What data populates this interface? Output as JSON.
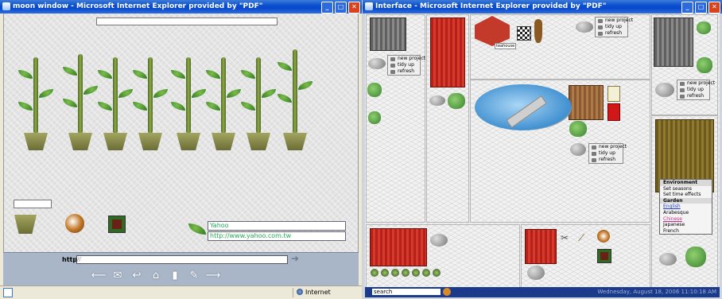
{
  "left_window": {
    "title": "moon window - Microsoft Internet Explorer provided by \"PDF\"",
    "buttons": {
      "minimize": "_",
      "maximize": "□",
      "close": "✕"
    },
    "fields": {
      "name_value": "Yahoo",
      "url_value": "http://www.yahoo.com.tw"
    },
    "address": {
      "label": "http:",
      "value": "//"
    },
    "nav_icons": [
      "⟵",
      "✉",
      "↩",
      "⌂",
      "▮",
      "✎",
      "⟶"
    ],
    "status": {
      "zone": "Internet"
    }
  },
  "right_window": {
    "title": "Interface - Microsoft Internet Explorer provided by \"PDF\"",
    "buttons": {
      "minimize": "_",
      "maximize": "□",
      "close": "✕"
    },
    "context_menu": [
      "new project",
      "tidy up",
      "refresh"
    ],
    "teahouse_label": "teahouse",
    "environment_menu": {
      "items": [
        {
          "label": "Environment",
          "kind": "header"
        },
        {
          "label": "Set seasons",
          "kind": "item"
        },
        {
          "label": "Set time effects",
          "kind": "item"
        },
        {
          "label": "Garden",
          "kind": "header"
        },
        {
          "label": "English",
          "kind": "link"
        },
        {
          "label": "Arabesque",
          "kind": "item"
        },
        {
          "label": "Chinese",
          "kind": "pink"
        },
        {
          "label": "Japanese",
          "kind": "item"
        },
        {
          "label": "French",
          "kind": "item"
        }
      ]
    },
    "search_label": "search",
    "datetime": "Wednesday, August 18, 2006 11:10:18 AM"
  }
}
